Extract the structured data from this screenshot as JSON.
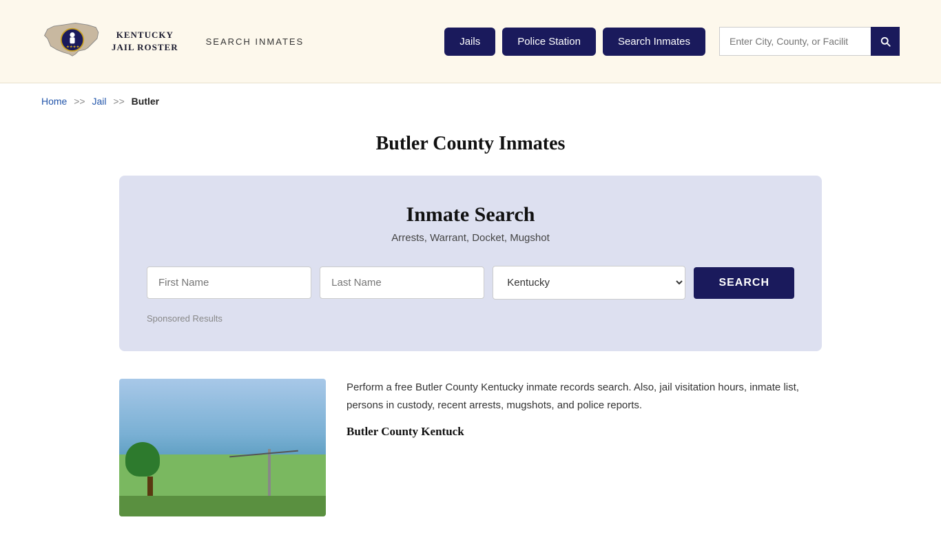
{
  "header": {
    "logo_line1": "KENTUCKY",
    "logo_line2": "JAIL ROSTER",
    "search_inmates_label": "SEARCH INMATES",
    "nav": {
      "jails_label": "Jails",
      "police_station_label": "Police Station",
      "search_inmates_label": "Search Inmates"
    },
    "search_input_placeholder": "Enter City, County, or Facilit"
  },
  "breadcrumb": {
    "home": "Home",
    "sep1": ">>",
    "jail": "Jail",
    "sep2": ">>",
    "current": "Butler"
  },
  "page": {
    "title": "Butler County Inmates"
  },
  "search_panel": {
    "title": "Inmate Search",
    "subtitle": "Arrests, Warrant, Docket, Mugshot",
    "first_name_placeholder": "First Name",
    "last_name_placeholder": "Last Name",
    "state_default": "Kentucky",
    "search_btn_label": "SEARCH",
    "sponsored_label": "Sponsored Results"
  },
  "bottom": {
    "description": "Perform a free Butler County Kentucky inmate records search. Also, jail visitation hours, inmate list, persons in custody, recent arrests, mugshots, and police reports.",
    "subtitle": "Butler County Kentuck"
  }
}
